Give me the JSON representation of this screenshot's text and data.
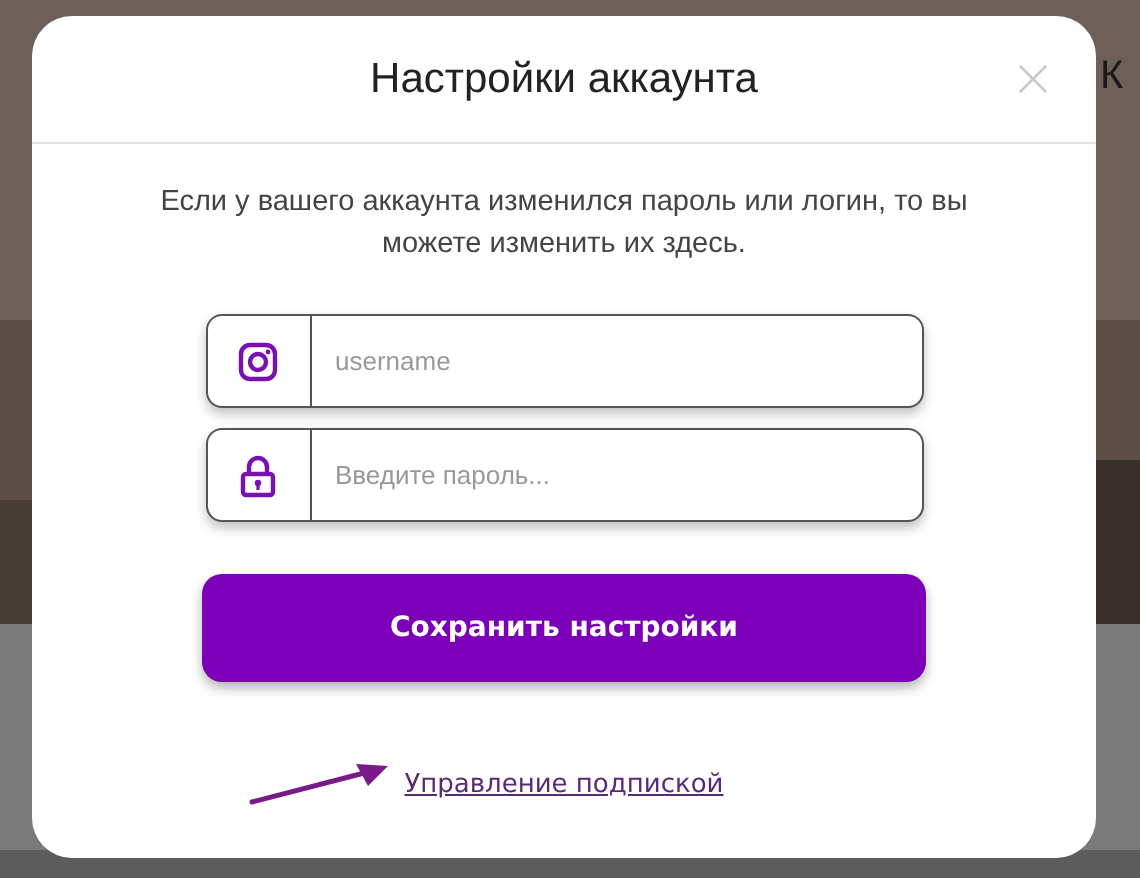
{
  "background": {
    "kind": "picture",
    "text": "К"
  },
  "dialog": {
    "title": "Настройки аккаунта",
    "description": "Если у вашего аккаунта изменился пароль или логин, то вы можете изменить их здесь.",
    "fields": [
      {
        "kind": "username",
        "placeholder": "username"
      },
      {
        "kind": "password",
        "placeholder": "Введите пароль..."
      }
    ],
    "save_button": "Сохранить настройки",
    "link": "Управление подпиской"
  }
}
